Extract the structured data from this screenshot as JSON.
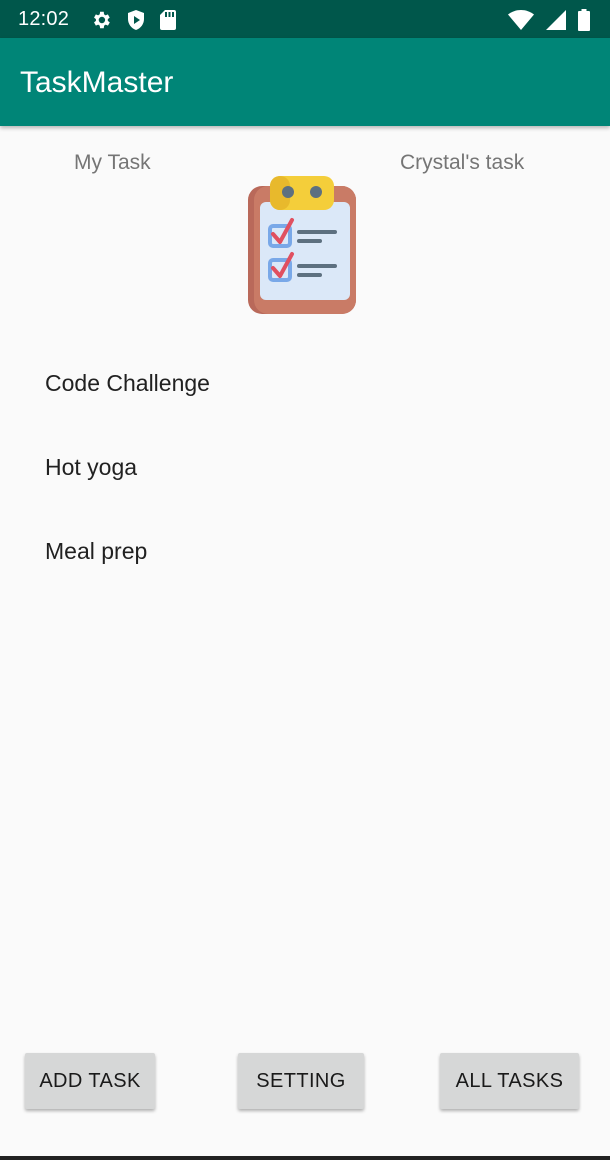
{
  "status_bar": {
    "time": "12:02",
    "icons": [
      "gear-icon",
      "shield-play-icon",
      "sd-card-icon",
      "wifi-icon",
      "signal-icon",
      "battery-icon"
    ]
  },
  "app_bar": {
    "title": "TaskMaster"
  },
  "header": {
    "left_label": "My Task",
    "right_label": "Crystal's task"
  },
  "tasks": [
    {
      "label": "Code Challenge"
    },
    {
      "label": "Hot yoga"
    },
    {
      "label": "Meal prep"
    }
  ],
  "buttons": {
    "add_task": "ADD TASK",
    "setting": "SETTING",
    "all_tasks": "ALL TASKS"
  },
  "colors": {
    "status_bar": "#00574b",
    "app_bar": "#008577",
    "background": "#fafafa"
  }
}
